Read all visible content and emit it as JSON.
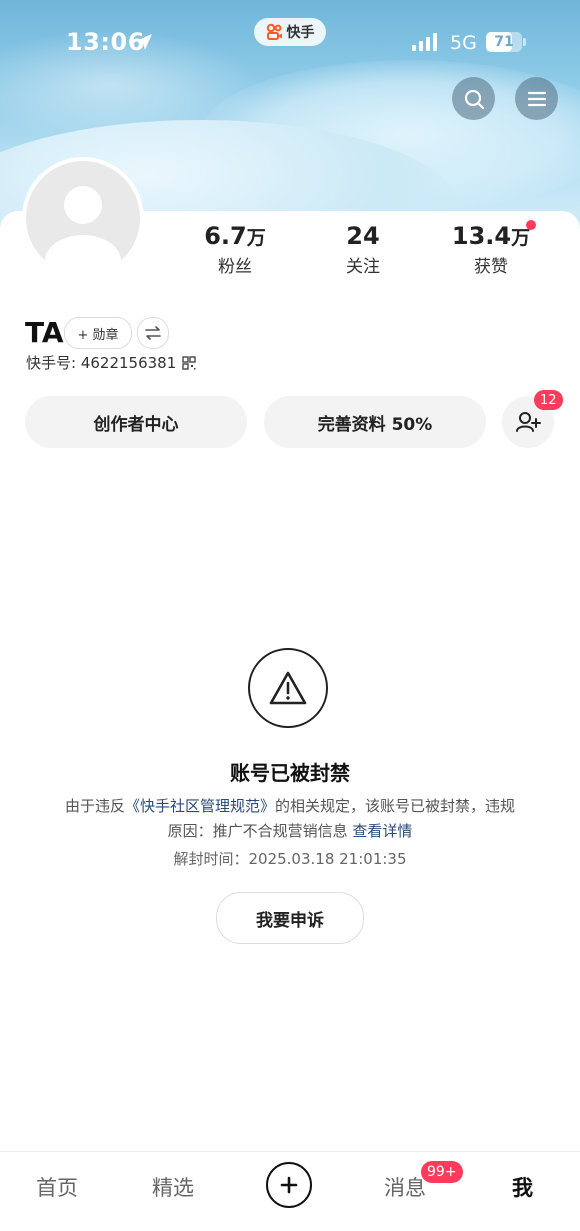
{
  "status_bar": {
    "time": "13:06",
    "network": "5G",
    "battery": "71",
    "battery_level": 0.71,
    "app_pill": "快手"
  },
  "profile": {
    "stats": [
      {
        "value": "6.7",
        "unit": "万",
        "label": "粉丝"
      },
      {
        "value": "24",
        "unit": "",
        "label": "关注"
      },
      {
        "value": "13.4",
        "unit": "万",
        "label": "获赞"
      }
    ],
    "name": "TA",
    "badge_chip": "+ 勋章",
    "kuaishou_id": "快手号: 4622156381",
    "creator_center": "创作者中心",
    "complete_profile": "完善资料 50%",
    "friend_request_count": "12"
  },
  "ban_notice": {
    "title": "账号已被封禁",
    "desc_prefix": "由于违反",
    "rule_link": "《快手社区管理规范》",
    "desc_middle": "的相关规定，该账号已被封禁，违规原因：推广不合规营销信息",
    "details_link": "查看详情",
    "unban_time": "解封时间：2025.03.18 21:01:35",
    "appeal_button": "我要申诉"
  },
  "bottom_nav": {
    "home": "首页",
    "featured": "精选",
    "messages": "消息",
    "messages_badge": "99+",
    "me": "我"
  },
  "colors": {
    "accent_red": "#ff3b5c",
    "link": "#2a4a7a",
    "header_blue": "#8fcbe8"
  }
}
